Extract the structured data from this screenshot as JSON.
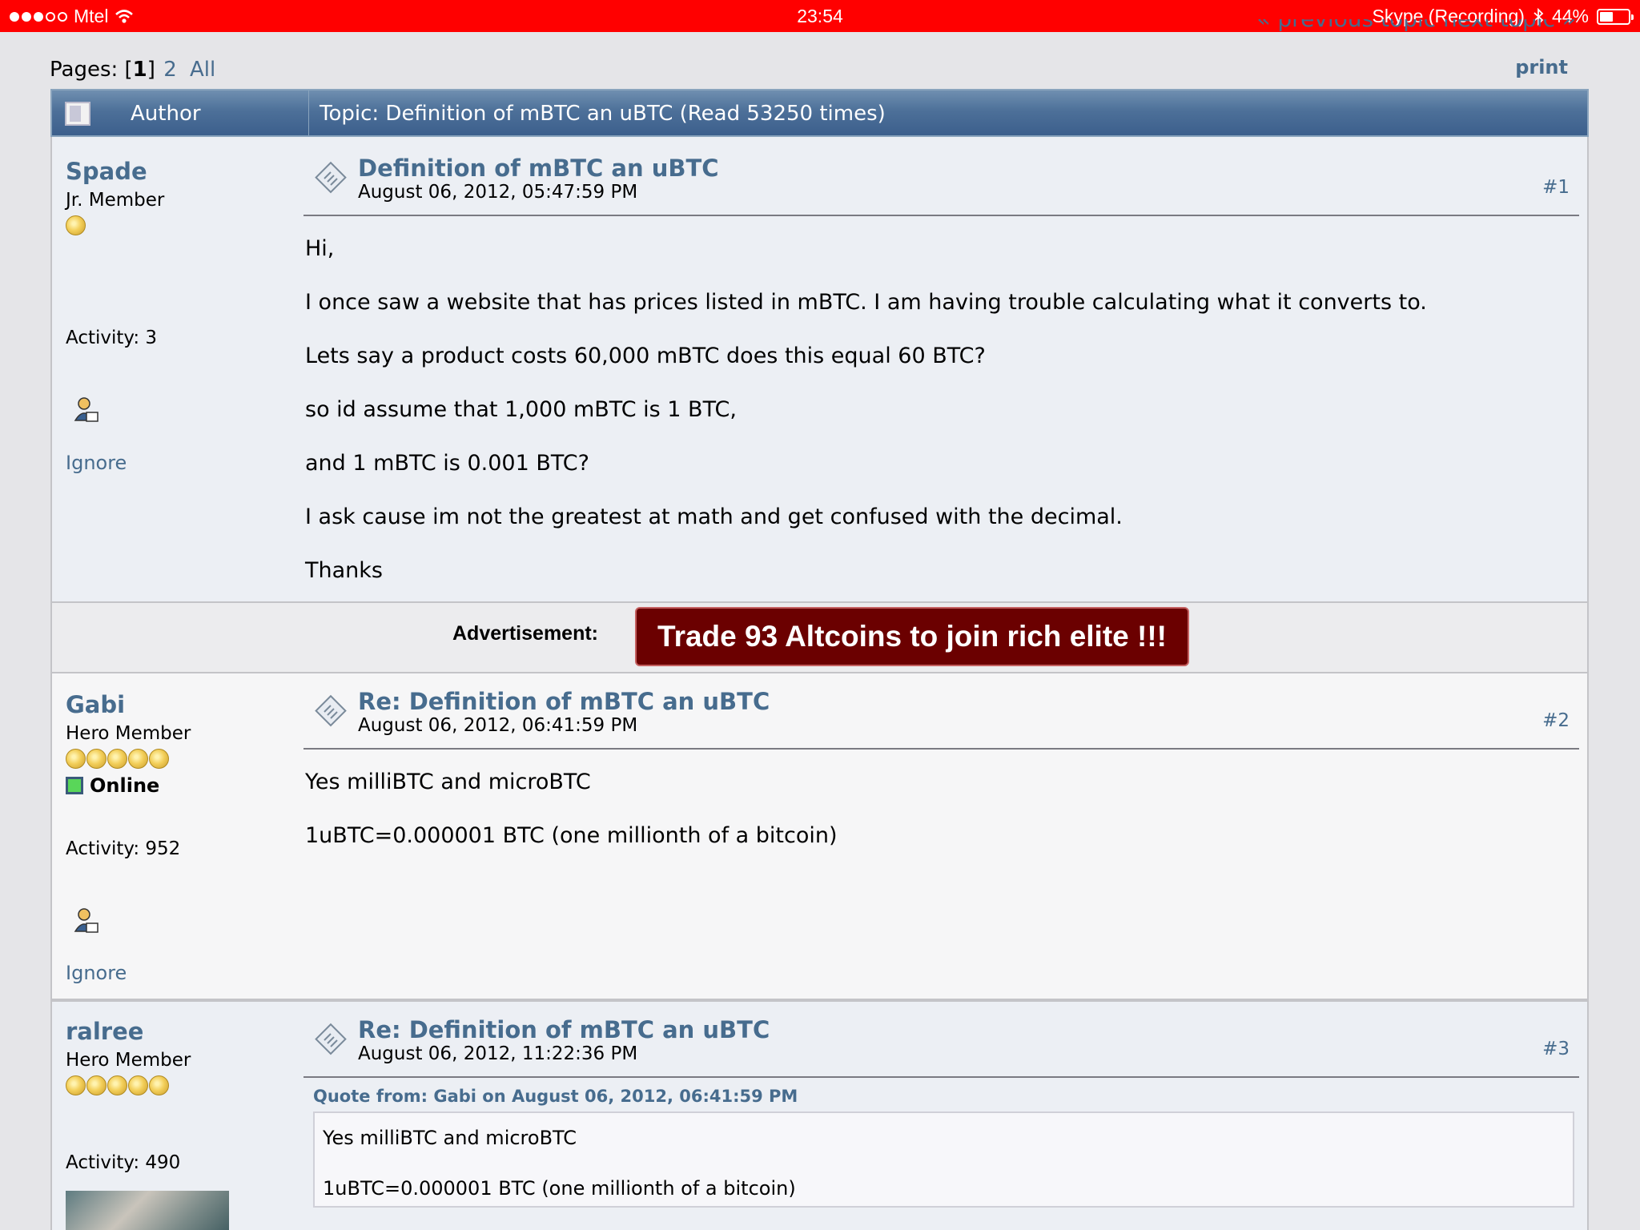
{
  "status_bar": {
    "carrier": "Mtel",
    "time": "23:54",
    "app_status": "Skype (Recording)",
    "battery": "44%",
    "battery_level": 0.44
  },
  "nav": {
    "prev_next": "« previous topic next topic »",
    "pages_label": "Pages:",
    "current_page": "1",
    "page_2": "2",
    "all": "All",
    "print": "print"
  },
  "header": {
    "author": "Author",
    "topic": "Topic: Definition of mBTC an uBTC  (Read 53250 times)"
  },
  "posts": [
    {
      "username": "Spade",
      "rank": "Jr. Member",
      "activity": "Activity: 3",
      "ignore": "Ignore",
      "title": "Definition of mBTC an uBTC",
      "date": "August 06, 2012, 05:47:59 PM",
      "number": "#1",
      "lines": [
        "Hi,",
        "I once saw a website that has prices listed in mBTC. I am having trouble calculating what it converts to.",
        "Lets say  a product costs 60,000 mBTC does this equal 60 BTC?",
        "so id assume that 1,000 mBTC is 1 BTC,",
        "and 1 mBTC is 0.001 BTC?",
        "I ask cause im not the greatest at math and get confused with the decimal.",
        "Thanks"
      ]
    },
    {
      "username": "Gabi",
      "rank": "Hero Member",
      "online": "Online",
      "activity": "Activity: 952",
      "ignore": "Ignore",
      "title": "Re: Definition of mBTC an uBTC",
      "date": "August 06, 2012, 06:41:59 PM",
      "number": "#2",
      "lines": [
        "Yes milliBTC and microBTC",
        "1uBTC=0.000001 BTC (one millionth of a bitcoin)"
      ]
    },
    {
      "username": "ralree",
      "rank": "Hero Member",
      "activity": "Activity: 490",
      "title": "Re: Definition of mBTC an uBTC",
      "date": "August 06, 2012, 11:22:36 PM",
      "number": "#3",
      "quote_header": "Quote from: Gabi on August 06, 2012, 06:41:59 PM",
      "quote_lines": [
        "Yes milliBTC and microBTC",
        "1uBTC=0.000001 BTC (one millionth of a bitcoin)"
      ]
    }
  ],
  "ad": {
    "label": "Advertisement:",
    "button": "Trade 93 Altcoins to join rich elite !!!"
  },
  "icons": [
    "wifi-icon",
    "bluetooth-icon",
    "battery-icon",
    "header-icon",
    "post-icon",
    "personal-message-icon",
    "star-icon",
    "online-indicator-icon"
  ],
  "colors": {
    "status_bar": "#ff0000",
    "link": "#476c8e",
    "header": "#4d7099",
    "ad_button": "#6b0000",
    "online": "#59d659"
  }
}
